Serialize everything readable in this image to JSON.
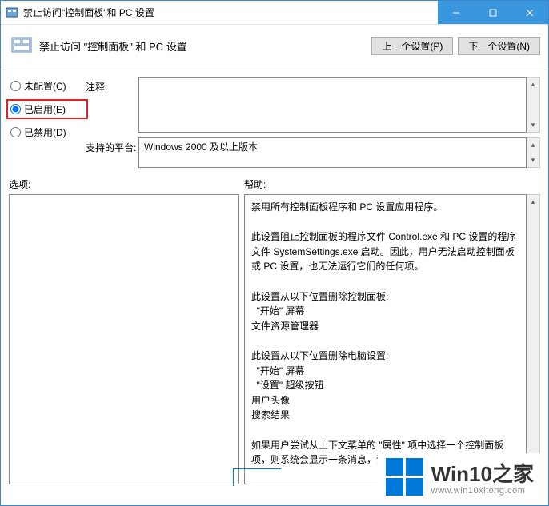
{
  "window": {
    "title": "禁止访问\"控制面板\"和 PC 设置"
  },
  "header": {
    "policy_title": "禁止访问 \"控制面板\" 和 PC 设置",
    "prev_btn": "上一个设置(P)",
    "next_btn": "下一个设置(N)"
  },
  "radio": {
    "not_configured": "未配置(C)",
    "enabled": "已启用(E)",
    "disabled": "已禁用(D)",
    "selected": "enabled"
  },
  "fields": {
    "comment_label": "注释:",
    "comment_value": "",
    "supported_label": "支持的平台:",
    "supported_value": "Windows 2000 及以上版本"
  },
  "sections": {
    "options_label": "选项:",
    "help_label": "帮助:"
  },
  "help_text": "禁用所有控制面板程序和 PC 设置应用程序。\n\n此设置阻止控制面板的程序文件 Control.exe 和 PC 设置的程序文件 SystemSettings.exe 启动。因此，用户无法启动控制面板或 PC 设置，也无法运行它们的任何项。\n\n此设置从以下位置删除控制面板:\n  \"开始\" 屏幕\n文件资源管理器\n\n此设置从以下位置删除电脑设置:\n  \"开始\" 屏幕\n  \"设置\" 超级按钮\n用户头像\n搜索结果\n\n如果用户尝试从上下文菜单的 \"属性\" 项中选择一个控制面板项，则系统会显示一条消息，说明设置禁止",
  "watermark": {
    "brand": "Win10",
    "suffix": "之家",
    "url": "www.win10xitong.com"
  }
}
